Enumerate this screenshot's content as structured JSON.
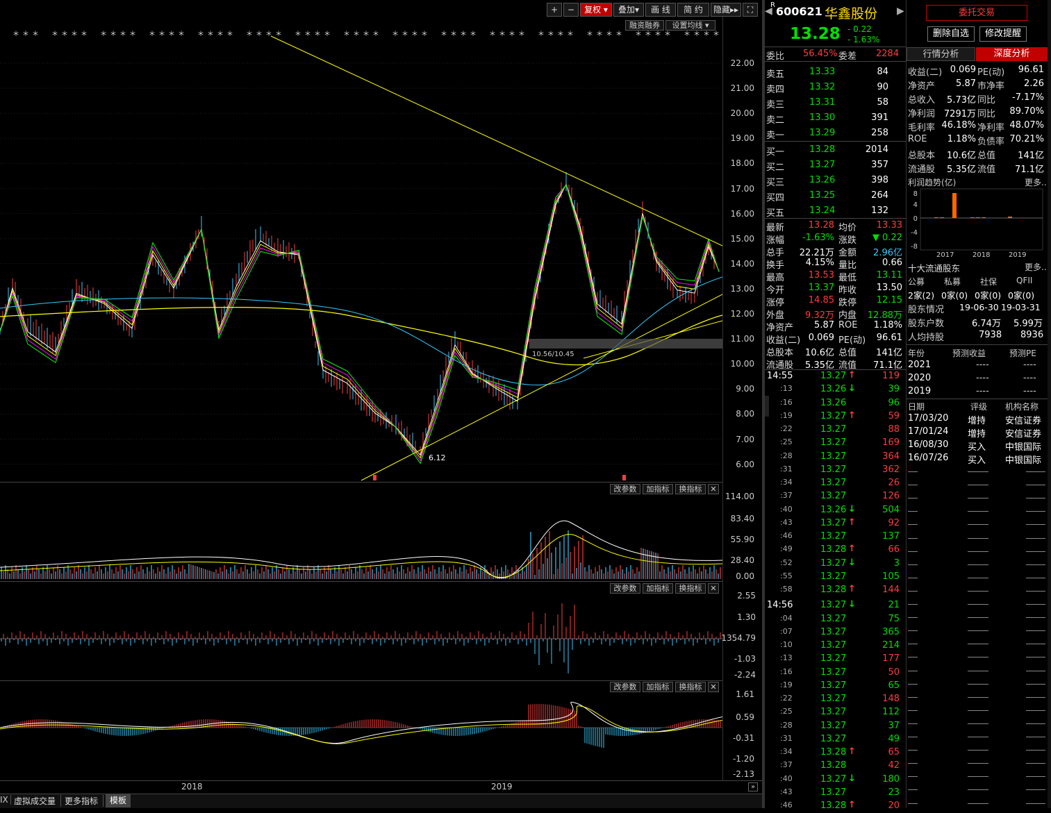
{
  "toolbar": {
    "plus": "+",
    "minus": "−",
    "fuquan": "复权 ▾",
    "diejia": "叠加▾",
    "huaxian": "画 线",
    "jianyue": "简 约",
    "yincang": "隐藏▸▸",
    "fullscreen": "⛶",
    "rongzi": "融资融券",
    "shezhi": "设置均线 ▾"
  },
  "main_axis": [
    "22.00",
    "21.00",
    "20.00",
    "19.00",
    "18.00",
    "17.00",
    "16.00",
    "15.00",
    "14.00",
    "13.00",
    "12.00",
    "11.00",
    "10.00",
    "9.00",
    "8.00",
    "7.00",
    "6.00"
  ],
  "annot": {
    "low": "6.12",
    "box": "10.56/10.45"
  },
  "vol_axis": [
    "114.00",
    "83.40",
    "55.90",
    "28.40",
    "0.00"
  ],
  "ind2_axis": [
    "2.55",
    "1.30",
    "1354.79",
    "-1.03",
    "-2.24"
  ],
  "macd_axis": [
    "1.61",
    "0.59",
    "-0.31",
    "-1.20",
    "-2.13"
  ],
  "panel_btns": {
    "gai": "改参数",
    "jia": "加指标",
    "huan": "换指标",
    "close": "✕"
  },
  "xaxis": {
    "y2018": "2018",
    "y2019": "2019"
  },
  "bottom_tabs": [
    "IX",
    "虚拟成交量",
    "更多指标",
    "模板"
  ],
  "quote": {
    "code": "600621",
    "name": "华鑫股份",
    "r": "R",
    "price": "13.28",
    "chg": "- 0.22",
    "pct": "- 1.63%",
    "weibi_l": "委比",
    "weibi": "56.45%",
    "weicha_l": "委差",
    "weicha": "2284",
    "sells": [
      [
        "卖五",
        "13.33",
        "84"
      ],
      [
        "卖四",
        "13.32",
        "90"
      ],
      [
        "卖三",
        "13.31",
        "58"
      ],
      [
        "卖二",
        "13.30",
        "391"
      ],
      [
        "卖一",
        "13.29",
        "258"
      ]
    ],
    "buys": [
      [
        "买一",
        "13.28",
        "2014"
      ],
      [
        "买二",
        "13.27",
        "357"
      ],
      [
        "买三",
        "13.26",
        "398"
      ],
      [
        "买四",
        "13.25",
        "264"
      ],
      [
        "买五",
        "13.24",
        "132"
      ]
    ],
    "stats": [
      [
        "最新",
        "13.28",
        "red",
        "均价",
        "13.33",
        "red"
      ],
      [
        "涨幅",
        "-1.63%",
        "green",
        "涨跌",
        "▼ 0.22",
        "green"
      ],
      [
        "总手",
        "22.21万",
        "white",
        "金额",
        "2.96亿",
        "cyan"
      ],
      [
        "换手",
        "4.15%",
        "white",
        "量比",
        "0.66",
        "white"
      ],
      [
        "最高",
        "13.53",
        "red",
        "最低",
        "13.11",
        "green"
      ],
      [
        "今开",
        "13.37",
        "green",
        "昨收",
        "13.50",
        "white"
      ],
      [
        "涨停",
        "14.85",
        "red",
        "跌停",
        "12.15",
        "green"
      ],
      [
        "外盘",
        "9.32万",
        "red",
        "内盘",
        "12.88万",
        "green"
      ],
      [
        "净资产",
        "5.87",
        "white",
        "ROE",
        "1.18%",
        "white"
      ],
      [
        "收益(二)",
        "0.069",
        "white",
        "PE(动)",
        "96.61",
        "white"
      ],
      [
        "总股本",
        "10.6亿",
        "white",
        "总值",
        "141亿",
        "white"
      ],
      [
        "流通股",
        "5.35亿",
        "white",
        "流值",
        "71.1亿",
        "white"
      ]
    ],
    "ticks": [
      [
        "14:55",
        "13.27",
        "↑",
        "119",
        "red"
      ],
      [
        ":13",
        "13.26",
        "↓",
        "39",
        "green"
      ],
      [
        ":16",
        "13.26",
        "",
        "96",
        "green"
      ],
      [
        ":19",
        "13.27",
        "↑",
        "59",
        "red"
      ],
      [
        ":22",
        "13.27",
        "",
        "88",
        "red"
      ],
      [
        ":25",
        "13.27",
        "",
        "169",
        "red"
      ],
      [
        ":28",
        "13.27",
        "",
        "364",
        "red"
      ],
      [
        ":31",
        "13.27",
        "",
        "362",
        "red"
      ],
      [
        ":34",
        "13.27",
        "",
        "26",
        "red"
      ],
      [
        ":37",
        "13.27",
        "",
        "126",
        "red"
      ],
      [
        ":40",
        "13.26",
        "↓",
        "504",
        "green"
      ],
      [
        ":43",
        "13.27",
        "↑",
        "92",
        "red"
      ],
      [
        ":46",
        "13.27",
        "",
        "137",
        "green"
      ],
      [
        ":49",
        "13.28",
        "↑",
        "66",
        "red"
      ],
      [
        ":52",
        "13.27",
        "↓",
        "3",
        "green"
      ],
      [
        ":55",
        "13.27",
        "",
        "105",
        "green"
      ],
      [
        ":58",
        "13.28",
        "↑",
        "144",
        "red"
      ],
      [
        "14:56",
        "13.27",
        "↓",
        "21",
        "green"
      ],
      [
        ":04",
        "13.27",
        "",
        "75",
        "green"
      ],
      [
        ":07",
        "13.27",
        "",
        "365",
        "green"
      ],
      [
        ":10",
        "13.27",
        "",
        "214",
        "green"
      ],
      [
        ":13",
        "13.27",
        "",
        "177",
        "red"
      ],
      [
        ":16",
        "13.27",
        "",
        "50",
        "red"
      ],
      [
        ":19",
        "13.27",
        "",
        "65",
        "green"
      ],
      [
        ":22",
        "13.27",
        "",
        "148",
        "red"
      ],
      [
        ":25",
        "13.27",
        "",
        "112",
        "green"
      ],
      [
        ":28",
        "13.27",
        "",
        "37",
        "green"
      ],
      [
        ":31",
        "13.27",
        "",
        "49",
        "green"
      ],
      [
        ":34",
        "13.28",
        "↑",
        "65",
        "red"
      ],
      [
        ":37",
        "13.28",
        "",
        "42",
        "red"
      ],
      [
        ":40",
        "13.27",
        "↓",
        "180",
        "green"
      ],
      [
        ":43",
        "13.27",
        "",
        "23",
        "green"
      ],
      [
        ":46",
        "13.28",
        "↑",
        "20",
        "red"
      ]
    ]
  },
  "right": {
    "trade": "委托交易",
    "del": "删除自选",
    "remind": "修改提醒",
    "tab1": "行情分析",
    "tab2": "深度分析",
    "fin": [
      [
        "收益(二)",
        "0.069",
        "PE(动)",
        "96.61"
      ],
      [
        "净资产",
        "5.87",
        "市净率",
        "2.26"
      ],
      [
        "总收入",
        "5.73亿",
        "同比",
        "-7.17%"
      ],
      [
        "净利润",
        "7291万",
        "同比",
        "89.70%"
      ],
      [
        "毛利率",
        "46.18%",
        "净利率",
        "48.07%"
      ],
      [
        "ROE",
        "1.18%",
        "负债率",
        "70.21%"
      ],
      [
        "总股本",
        "10.6亿",
        "总值",
        "141亿"
      ],
      [
        "流通股",
        "5.35亿",
        "流值",
        "71.1亿"
      ]
    ],
    "profit_title": "利润趋势(亿)",
    "more": "更多..",
    "profit_axis": [
      "8",
      "4",
      "0",
      "-4",
      "-8"
    ],
    "profit_years": [
      "2017",
      "2018",
      "2019"
    ],
    "top10": "十大流通股东",
    "hold_heads": [
      "公募",
      "私募",
      "社保",
      "QFII"
    ],
    "hold_vals": [
      "2家(2)",
      "0家(0)",
      "0家(0)",
      "0家(0)"
    ],
    "gd_l": "股东情况",
    "gd_d1": "19-06-30",
    "gd_d2": "19-03-31",
    "hs_l": "股东户数",
    "hs1": "6.74万",
    "hs2": "5.99万",
    "rj_l": "人均持股",
    "rj1": "7938",
    "rj2": "8936",
    "fc_heads": [
      "年份",
      "预测收益",
      "预测PE"
    ],
    "fc_rows": [
      [
        "2021",
        "----",
        "----"
      ],
      [
        "2020",
        "----",
        "----"
      ],
      [
        "2019",
        "----",
        "----"
      ]
    ],
    "rt_heads": [
      "日期",
      "评级",
      "机构名称"
    ],
    "rt_rows": [
      [
        "17/03/20",
        "增持",
        "安信证券"
      ],
      [
        "17/01/24",
        "增持",
        "安信证券"
      ],
      [
        "16/08/30",
        "买入",
        "中银国际"
      ],
      [
        "16/07/26",
        "买入",
        "中银国际"
      ]
    ]
  }
}
